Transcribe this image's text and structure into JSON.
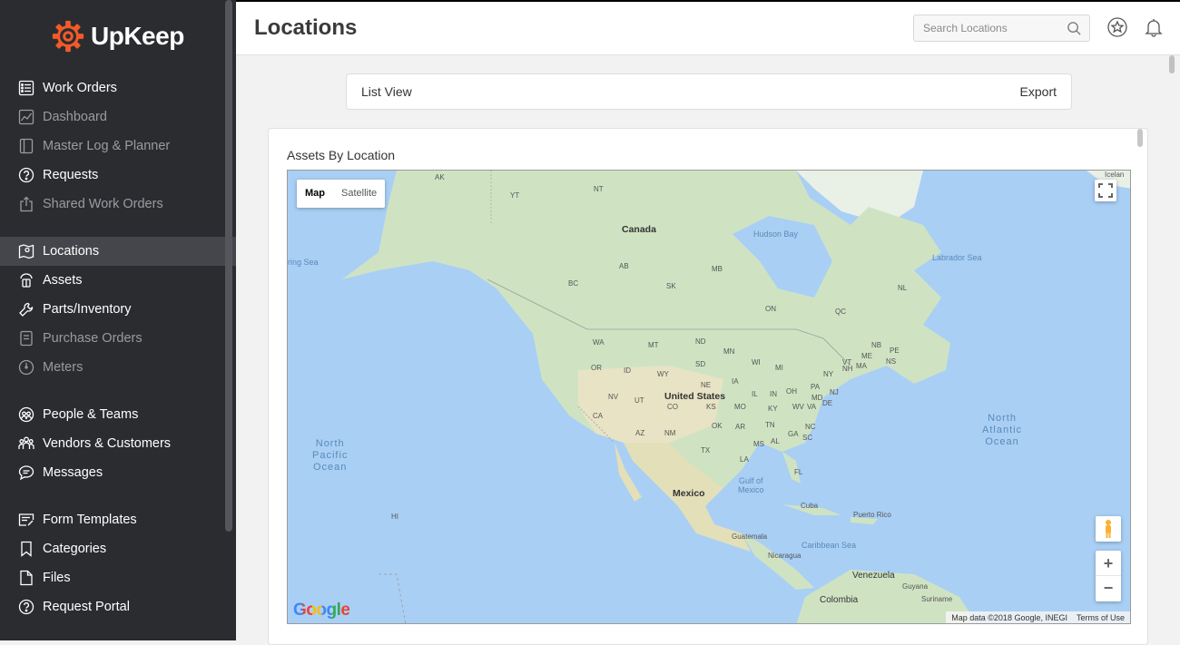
{
  "brand": {
    "name": "UpKeep"
  },
  "sidebar": {
    "items": [
      {
        "label": "Work Orders"
      },
      {
        "label": "Dashboard"
      },
      {
        "label": "Master Log & Planner"
      },
      {
        "label": "Requests"
      },
      {
        "label": "Shared Work Orders"
      },
      {
        "label": "Locations"
      },
      {
        "label": "Assets"
      },
      {
        "label": "Parts/Inventory"
      },
      {
        "label": "Purchase Orders"
      },
      {
        "label": "Meters"
      },
      {
        "label": "People & Teams"
      },
      {
        "label": "Vendors & Customers"
      },
      {
        "label": "Messages"
      },
      {
        "label": "Form Templates"
      },
      {
        "label": "Categories"
      },
      {
        "label": "Files"
      },
      {
        "label": "Request Portal"
      }
    ]
  },
  "header": {
    "title": "Locations",
    "search_placeholder": "Search Locations"
  },
  "viewbar": {
    "list_view": "List View",
    "export": "Export"
  },
  "card": {
    "title": "Assets By Location"
  },
  "map": {
    "type_map": "Map",
    "type_satellite": "Satellite",
    "zoom_in": "+",
    "zoom_out": "−",
    "attribution": "Map data ©2018 Google, INEGI",
    "terms": "Terms of Use",
    "logo": "Google",
    "labels": {
      "canada": "Canada",
      "us": "United States",
      "mexico": "Mexico",
      "hudson": "Hudson Bay",
      "labrador": "Labrador Sea",
      "bering": "ring Sea",
      "iceland": "Icelan",
      "npac": "North\nPacific\nOcean",
      "natl": "North\nAtlantic\nOcean",
      "gulf": "Gulf of\nMexico",
      "carib": "Caribbean Sea",
      "cuba": "Cuba",
      "pr": "Puerto Rico",
      "guat": "Guatemala",
      "nic": "Nicaragua",
      "ven": "Venezuela",
      "col": "Colombia",
      "guy": "Guyana",
      "sur": "Suriname",
      "hi": "HI",
      "ak": "AK",
      "yt": "YT",
      "nt": "NT",
      "ab": "AB",
      "mb": "MB",
      "sk": "SK",
      "bc": "BC",
      "on": "ON",
      "qc": "QC",
      "nl": "NL",
      "nb": "NB",
      "pe": "PE",
      "ns": "NS",
      "wa": "WA",
      "mt": "MT",
      "nd": "ND",
      "mn": "MN",
      "or": "OR",
      "id": "ID",
      "wy": "WY",
      "sd": "SD",
      "wi": "WI",
      "mi": "MI",
      "ny": "NY",
      "me": "ME",
      "vt": "VT",
      "nh": "NH",
      "ma": "MA",
      "ne": "NE",
      "ia": "IA",
      "il": "IL",
      "in": "IN",
      "oh": "OH",
      "pa": "PA",
      "nj": "NJ",
      "md": "MD",
      "de": "DE",
      "nv": "NV",
      "ut": "UT",
      "co": "CO",
      "ks": "KS",
      "mo": "MO",
      "ky": "KY",
      "wv": "WV",
      "va": "VA",
      "ca": "CA",
      "az": "AZ",
      "nm": "NM",
      "ok": "OK",
      "ar": "AR",
      "tn": "TN",
      "nc": "NC",
      "tx": "TX",
      "la": "LA",
      "ms": "MS",
      "al": "AL",
      "ga": "GA",
      "sc": "SC",
      "fl": "FL"
    }
  },
  "colors": {
    "accent": "#f15a29",
    "sidebar_bg": "#2b2c30",
    "active_bg": "#45464b",
    "water": "#a9cff5",
    "land": "#cfe3c3"
  }
}
